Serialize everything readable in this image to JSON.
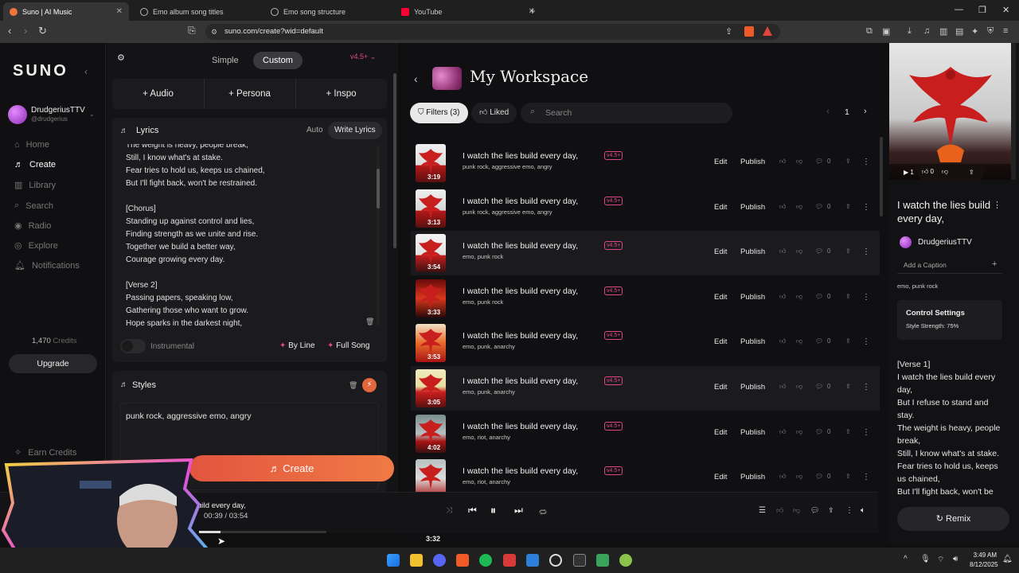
{
  "browser": {
    "tabs": [
      {
        "label": "Suno | AI Music",
        "color": "#f0743c"
      },
      {
        "label": "Emo album song titles",
        "color": "#b8b8b8"
      },
      {
        "label": "Emo song structure",
        "color": "#b8b8b8"
      },
      {
        "label": "YouTube",
        "color": "#ff0033"
      }
    ],
    "url": "suno.com/create?wid=default"
  },
  "nav": {
    "logo": "SUNO",
    "user_name": "DrudgeriusTTV",
    "user_handle": "@drudgerius",
    "items": [
      "Home",
      "Create",
      "Library",
      "Search",
      "Radio",
      "Explore",
      "Notifications"
    ],
    "credits_value": "1,470",
    "credits_label": "Credits",
    "upgrade": "Upgrade",
    "earn": "Earn Credits"
  },
  "create": {
    "mode_simple": "Simple",
    "mode_custom": "Custom",
    "version": "v4.5+",
    "audio": "Audio",
    "persona": "Persona",
    "inspo": "Inspo",
    "lyrics_title": "Lyrics",
    "auto": "Auto",
    "write_lyrics": "Write Lyrics",
    "lyrics": [
      "The weight is heavy, people break,",
      "Still, I know what's at stake.",
      "Fear tries to hold us, keeps us chained,",
      "But I'll fight back, won't be restrained.",
      "",
      "[Chorus]",
      "Standing up against control and lies,",
      "Finding strength as we unite and rise.",
      "Together we build a better way,",
      "Courage growing every day.",
      "",
      "[Verse 2]",
      "Passing papers, speaking low,",
      "Gathering those who want to grow.",
      "Hope sparks in the darkest night,"
    ],
    "instrumental": "Instrumental",
    "by_line": "By Line",
    "full_song": "Full Song",
    "styles_title": "Styles",
    "styles_value": "punk rock, aggressive emo, angry",
    "create_button": "Create"
  },
  "workspace": {
    "title": "My Workspace",
    "filters": "Filters (3)",
    "liked": "Liked",
    "search_placeholder": "Search",
    "page": "1",
    "edit_label": "Edit",
    "publish_label": "Publish",
    "songs": [
      {
        "title": "I watch the lies build every day,",
        "badge": "v4.5+",
        "genre": "punk rock, aggressive emo, angry",
        "duration": "3:19",
        "likes": "0"
      },
      {
        "title": "I watch the lies build every day,",
        "badge": "v4.5+",
        "genre": "punk rock, aggressive emo, angry",
        "duration": "3:13",
        "likes": "0"
      },
      {
        "title": "I watch the lies build every day,",
        "badge": "v4.5+",
        "genre": "emo, punk rock",
        "duration": "3:54",
        "likes": "0"
      },
      {
        "title": "I watch the lies build every day,",
        "badge": "v4.5+",
        "genre": "emo, punk rock",
        "duration": "3:33",
        "likes": "0"
      },
      {
        "title": "I watch the lies build every day,",
        "badge": "v4.5+",
        "genre": "emo, punk, anarchy",
        "duration": "3:53",
        "likes": "0"
      },
      {
        "title": "I watch the lies build every day,",
        "badge": "v4.5+",
        "genre": "emo, punk, anarchy",
        "duration": "3:05",
        "likes": "0"
      },
      {
        "title": "I watch the lies build every day,",
        "badge": "v4.5+",
        "genre": "emo, riot, anarchy",
        "duration": "4:02",
        "likes": "0"
      },
      {
        "title": "I watch the lies build every day,",
        "badge": "v4.5+",
        "genre": "emo, riot, anarchy",
        "duration": "",
        "likes": "0"
      }
    ],
    "last_duration": "3:32"
  },
  "detail": {
    "play_count": "1",
    "like_count": "0",
    "title": "I watch the lies build every day,",
    "artist": "DrudgeriusTTV",
    "add_caption": "Add a Caption",
    "genre": "emo, punk rock",
    "control_title": "Control Settings",
    "style_strength": "Style Strength: 75%",
    "lyrics": [
      "[Verse 1]",
      "I watch the lies build every",
      "day,",
      "But I refuse to stand and",
      "stay.",
      "The weight is heavy, people",
      "break,",
      "Still, I know what's at stake.",
      "Fear tries to hold us, keeps",
      "us chained,",
      "But I'll fight back, won't be"
    ],
    "remix": "Remix"
  },
  "player": {
    "now_playing": "build every day,",
    "time": "00:39 /  03:54",
    "progress": 0.17
  },
  "taskbar": {
    "time": "3:49 AM",
    "date": "8/12/2025"
  }
}
